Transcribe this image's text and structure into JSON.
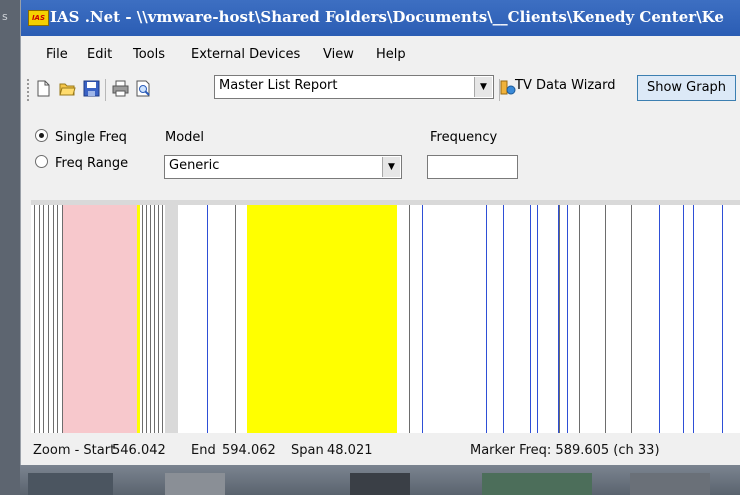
{
  "window": {
    "title": "IAS .Net - \\\\vmware-host\\Shared Folders\\Documents\\__Clients\\Kenedy Center\\Ke",
    "app_icon_label": "IAS",
    "left_edge_char": "s"
  },
  "menu": {
    "items": [
      "File",
      "Edit",
      "Tools",
      "External Devices",
      "View",
      "Help"
    ]
  },
  "toolbar": {
    "icons": [
      "new-file-icon",
      "open-folder-icon",
      "save-icon",
      "print-icon",
      "print-preview-icon"
    ],
    "report_select": "Master List Report",
    "wizard_label": "TV Data Wizard",
    "show_graph_label": "Show Graph"
  },
  "controls": {
    "mode_single": "Single Freq",
    "mode_range": "Freq Range",
    "mode_selected": "single",
    "model_label": "Model",
    "model_value": "Generic",
    "frequency_label": "Frequency",
    "frequency_value": ""
  },
  "graph": {
    "colors": {
      "overview_bg": "#ffffff",
      "overview_band": "#f7c8cc",
      "highlight": "#ffff00",
      "marker_line": "#2e4fd6",
      "neutral_line": "#6d6d6d"
    }
  },
  "status": {
    "zoom_start_label": "Zoom - Start",
    "zoom_start": "546.042",
    "end_label": "End",
    "end": "594.062",
    "span_label": "Span",
    "span": "48.021",
    "marker_text": "Marker Freq: 589.605 (ch 33)"
  }
}
